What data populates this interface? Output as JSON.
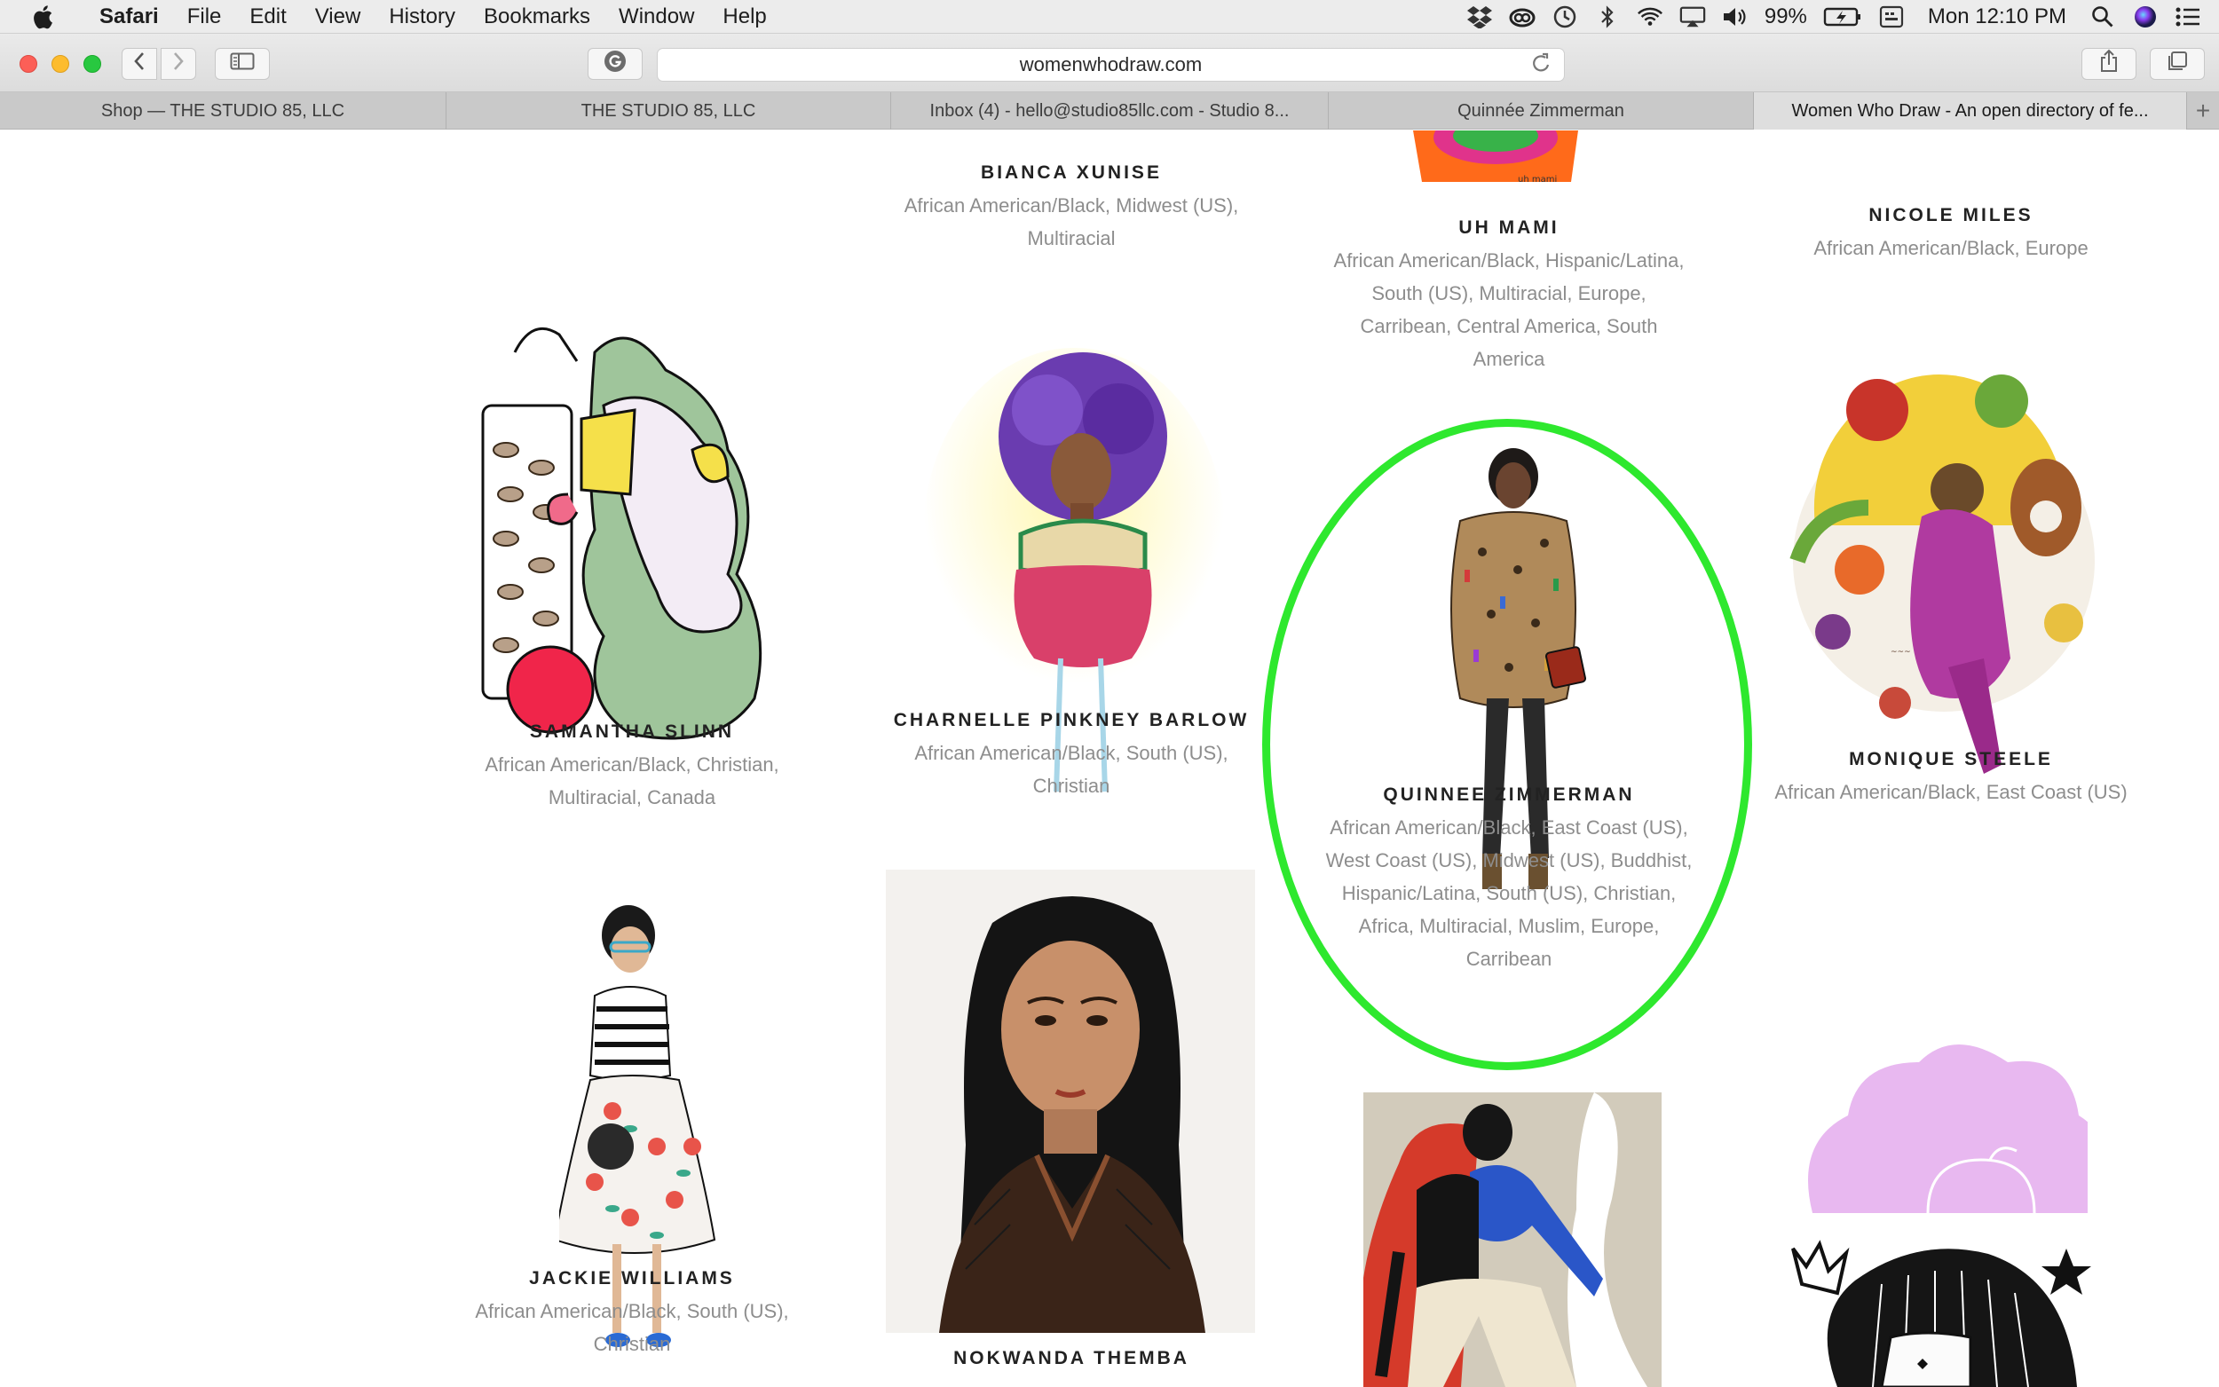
{
  "menubar": {
    "app": "Safari",
    "menus": [
      "File",
      "Edit",
      "View",
      "History",
      "Bookmarks",
      "Window",
      "Help"
    ],
    "battery": "99%",
    "clock": "Mon 12:10 PM"
  },
  "browser": {
    "url": "womenwhodraw.com",
    "tabs": [
      "Shop — THE STUDIO 85, LLC",
      "THE STUDIO 85, LLC",
      "Inbox (4) - hello@studio85llc.com - Studio 8...",
      "Quinnée Zimmerman",
      "Women Who Draw - An open directory of fe..."
    ],
    "active_tab_index": 4
  },
  "artists": [
    {
      "name": "BIANCA XUNISE",
      "tags": "African American/Black, Midwest (US), Multiracial"
    },
    {
      "name": "UH MAMI",
      "tags": "African American/Black, Hispanic/Latina, South (US), Multiracial, Europe, Carribean, Central America, South America"
    },
    {
      "name": "NICOLE MILES",
      "tags": "African American/Black, Europe"
    },
    {
      "name": "SAMANTHA SLINN",
      "tags": "African American/Black, Christian, Multiracial, Canada"
    },
    {
      "name": "CHARNELLE PINKNEY BARLOW",
      "tags": "African American/Black, South (US), Christian"
    },
    {
      "name": "QUINNEE ZIMMERMAN",
      "tags": "African American/Black, East Coast (US), West Coast (US), Midwest (US), Buddhist, Hispanic/Latina, South (US), Christian, Africa, Multiracial, Muslim, Europe, Carribean"
    },
    {
      "name": "MONIQUE STEELE",
      "tags": "African American/Black, East Coast (US)"
    },
    {
      "name": "JACKIE WILLIAMS",
      "tags": "African American/Black, South (US), Christian"
    },
    {
      "name": "NOKWANDA THEMBA",
      "tags": ""
    }
  ],
  "colors": {
    "highlight": "#2ee82e",
    "tag_text": "#8d8d8d",
    "name_text": "#222222"
  }
}
